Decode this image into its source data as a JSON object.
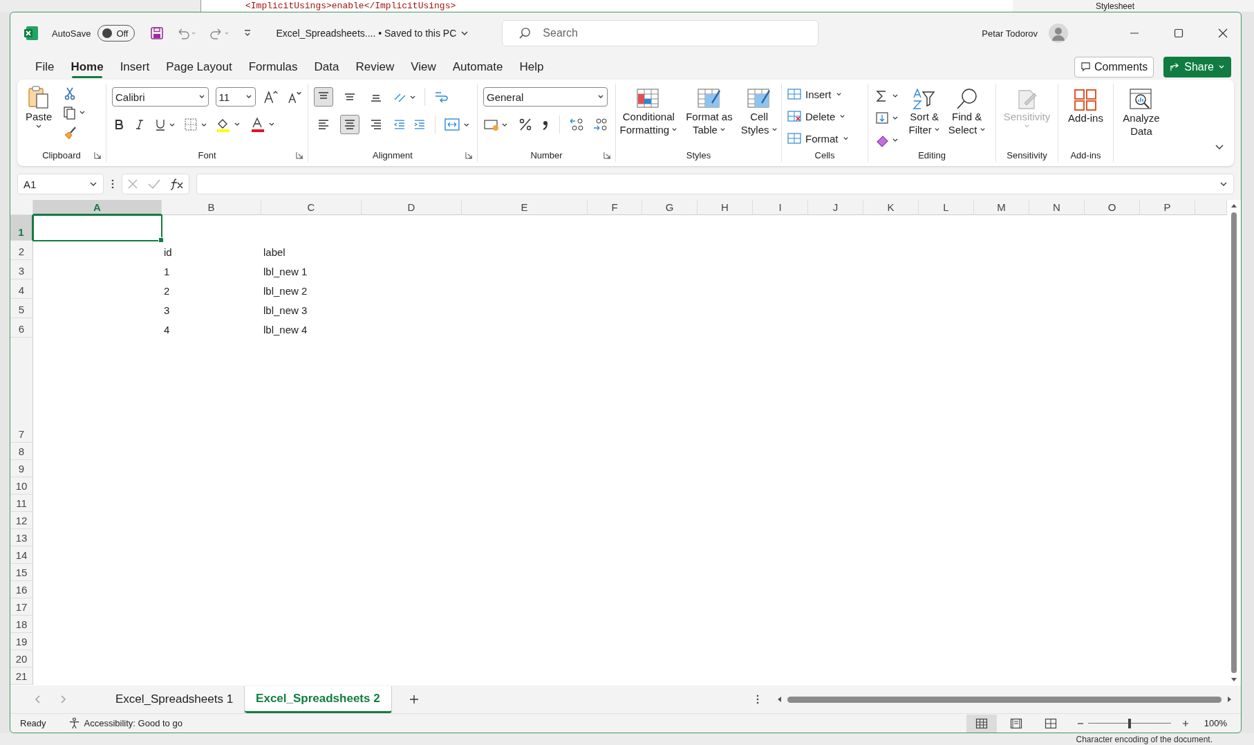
{
  "background": {
    "code_line": "<ImplicitUsings>enable</ImplicitUsings>",
    "side_title": "Stylesheet",
    "side_text": "Character encoding of the document."
  },
  "title_bar": {
    "autosave_label": "AutoSave",
    "autosave": {
      "on": false,
      "label": "Off"
    },
    "file": "Excel_Spreadsheets.... • Saved to this PC",
    "search_placeholder": "Search",
    "user": "Petar Todorov"
  },
  "menu_tabs": [
    {
      "label": "File",
      "selected": false
    },
    {
      "label": "Home",
      "selected": true
    },
    {
      "label": "Insert",
      "selected": false
    },
    {
      "label": "Page Layout",
      "selected": false
    },
    {
      "label": "Formulas",
      "selected": false
    },
    {
      "label": "Data",
      "selected": false
    },
    {
      "label": "Review",
      "selected": false
    },
    {
      "label": "View",
      "selected": false
    },
    {
      "label": "Automate",
      "selected": false
    },
    {
      "label": "Help",
      "selected": false
    }
  ],
  "comments": "Comments",
  "share": "Share",
  "ribbon": {
    "clipboard": {
      "label": "Clipboard",
      "paste": "Paste"
    },
    "font": {
      "label": "Font",
      "name": "Calibri",
      "size": "11"
    },
    "alignment": {
      "label": "Alignment",
      "vertical": [
        {
          "selected": true
        },
        {
          "selected": false
        },
        {
          "selected": false
        }
      ],
      "horizontal": [
        {
          "selected": false
        },
        {
          "selected": true
        },
        {
          "selected": false
        }
      ]
    },
    "number": {
      "label": "Number",
      "format": "General"
    },
    "styles": {
      "label": "Styles",
      "buttons": [
        {
          "lines": [
            "Conditional",
            "Formatting"
          ]
        },
        {
          "lines": [
            "Format as",
            "Table"
          ]
        },
        {
          "lines": [
            "Cell",
            "Styles"
          ]
        }
      ]
    },
    "cells": {
      "label": "Cells",
      "buttons": [
        "Insert",
        "Delete",
        "Format"
      ]
    },
    "editing": {
      "label": "Editing",
      "buttons": [
        {
          "lines": [
            "Sort &",
            "Filter"
          ]
        },
        {
          "lines": [
            "Find &",
            "Select"
          ]
        }
      ]
    },
    "sensitivity": {
      "label": "Sensitivity",
      "button": "Sensitivity",
      "disabled": true
    },
    "addins": {
      "label": "Add-ins",
      "button": "Add-ins"
    },
    "analyze": {
      "lines": [
        "Analyze",
        "Data"
      ]
    }
  },
  "formula_bar": {
    "name_box": "A1"
  },
  "sheet": {
    "columns": [
      {
        "label": "A",
        "selected": true
      },
      {
        "label": "B",
        "selected": false
      },
      {
        "label": "C",
        "selected": false
      },
      {
        "label": "D",
        "selected": false
      },
      {
        "label": "E",
        "selected": false
      },
      {
        "label": "F",
        "selected": false
      },
      {
        "label": "G",
        "selected": false
      },
      {
        "label": "H",
        "selected": false
      },
      {
        "label": "I",
        "selected": false
      },
      {
        "label": "J",
        "selected": false
      },
      {
        "label": "K",
        "selected": false
      },
      {
        "label": "L",
        "selected": false
      },
      {
        "label": "M",
        "selected": false
      },
      {
        "label": "N",
        "selected": false
      },
      {
        "label": "O",
        "selected": false
      },
      {
        "label": "P",
        "selected": false
      }
    ],
    "rows": [
      {
        "number": "1",
        "selected": true
      },
      {
        "number": "2",
        "selected": false,
        "values": {
          "B": "id",
          "C": "label"
        }
      },
      {
        "number": "3",
        "selected": false,
        "values": {
          "B": "1",
          "C": "lbl_new 1"
        }
      },
      {
        "number": "4",
        "selected": false,
        "values": {
          "B": "2",
          "C": "lbl_new 2"
        }
      },
      {
        "number": "5",
        "selected": false,
        "values": {
          "B": "3",
          "C": "lbl_new 3"
        }
      },
      {
        "number": "6",
        "selected": false,
        "values": {
          "B": "4",
          "C": "lbl_new 4"
        }
      },
      {
        "number": "7",
        "selected": false
      },
      {
        "number": "8",
        "selected": false
      },
      {
        "number": "9",
        "selected": false
      },
      {
        "number": "10",
        "selected": false
      },
      {
        "number": "11",
        "selected": false
      },
      {
        "number": "12",
        "selected": false
      },
      {
        "number": "13",
        "selected": false
      },
      {
        "number": "14",
        "selected": false
      },
      {
        "number": "15",
        "selected": false
      },
      {
        "number": "16",
        "selected": false
      },
      {
        "number": "17",
        "selected": false
      },
      {
        "number": "18",
        "selected": false
      },
      {
        "number": "19",
        "selected": false
      },
      {
        "number": "20",
        "selected": false
      },
      {
        "number": "21",
        "selected": false
      }
    ]
  },
  "sheet_tabs": [
    {
      "label": "Excel_Spreadsheets 1",
      "selected": false
    },
    {
      "label": "Excel_Spreadsheets 2",
      "selected": true
    }
  ],
  "status_bar": {
    "ready": "Ready",
    "accessibility": "Accessibility: Good to go",
    "views": [
      {
        "selected": true
      },
      {
        "selected": false
      },
      {
        "selected": false
      }
    ],
    "zoom": {
      "level": 0.5,
      "reading": "100%"
    }
  }
}
